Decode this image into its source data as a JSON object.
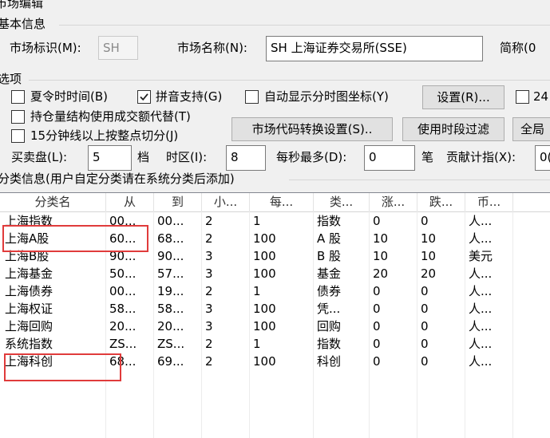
{
  "window": {
    "title": "市场编辑"
  },
  "basic": {
    "section_title": "基本信息",
    "market_id_label": "市场标识(M):",
    "market_id_value": "SH",
    "market_name_label": "市场名称(N):",
    "market_name_value": "SH 上海证券交易所(SSE)",
    "short_name_label": "简称(0"
  },
  "options": {
    "section_title": "选项",
    "dst_label": "夏令时时间(B)",
    "dst_checked": false,
    "pinyin_label": "拼音支持(G)",
    "pinyin_checked": true,
    "auto_coord_label": "自动显示分时图坐标(Y)",
    "auto_coord_checked": false,
    "settings_button": "设置(R)...",
    "h24_label": "24",
    "h24_checked": false,
    "position_label": "持仓量结构使用成交额代替(T)",
    "position_checked": false,
    "min15_label": "15分钟线以上按整点切分(J)",
    "min15_checked": false,
    "code_convert_button": "市场代码转换设置(S)..",
    "filter_button": "使用时段过滤",
    "global_button": "全局",
    "bidask_label": "买卖盘(L):",
    "bidask_value": "5",
    "bidask_unit": "档",
    "timezone_label": "时区(I):",
    "timezone_value": "8",
    "maxpersec_label": "每秒最多(D):",
    "maxpersec_value": "0",
    "maxpersec_unit": "笔",
    "contrib_label": "贡献计指(X):",
    "contrib_value": "0("
  },
  "category": {
    "section_title": "分类信息(用户自定分类请在系统分类后添加)",
    "columns": [
      "分类名",
      "从",
      "到",
      "小...",
      "每...",
      "类...",
      "涨...",
      "跌...",
      "币..."
    ],
    "rows": [
      [
        "上海指数",
        "00...",
        "00...",
        "2",
        "1",
        "指数",
        "0",
        "0",
        "人..."
      ],
      [
        "上海A股",
        "60...",
        "68...",
        "2",
        "100",
        "A 股",
        "10",
        "10",
        "人..."
      ],
      [
        "上海B股",
        "90...",
        "90...",
        "3",
        "100",
        "B 股",
        "10",
        "10",
        "美元"
      ],
      [
        "上海基金",
        "50...",
        "57...",
        "3",
        "100",
        "基金",
        "20",
        "20",
        "人..."
      ],
      [
        "上海债券",
        "00...",
        "19...",
        "2",
        "1",
        "债券",
        "0",
        "0",
        "人..."
      ],
      [
        "上海权证",
        "58...",
        "58...",
        "3",
        "100",
        "凭...",
        "0",
        "0",
        "人..."
      ],
      [
        "上海回购",
        "20...",
        "20...",
        "3",
        "100",
        "回购",
        "0",
        "0",
        "人..."
      ],
      [
        "系统指数",
        "ZS...",
        "ZS...",
        "2",
        "1",
        "指数",
        "0",
        "0",
        "人..."
      ],
      [
        "上海科创",
        "68...",
        "69...",
        "2",
        "100",
        "科创",
        "0",
        "0",
        "人..."
      ]
    ]
  },
  "colors": {
    "highlight": "#e03b3b"
  }
}
